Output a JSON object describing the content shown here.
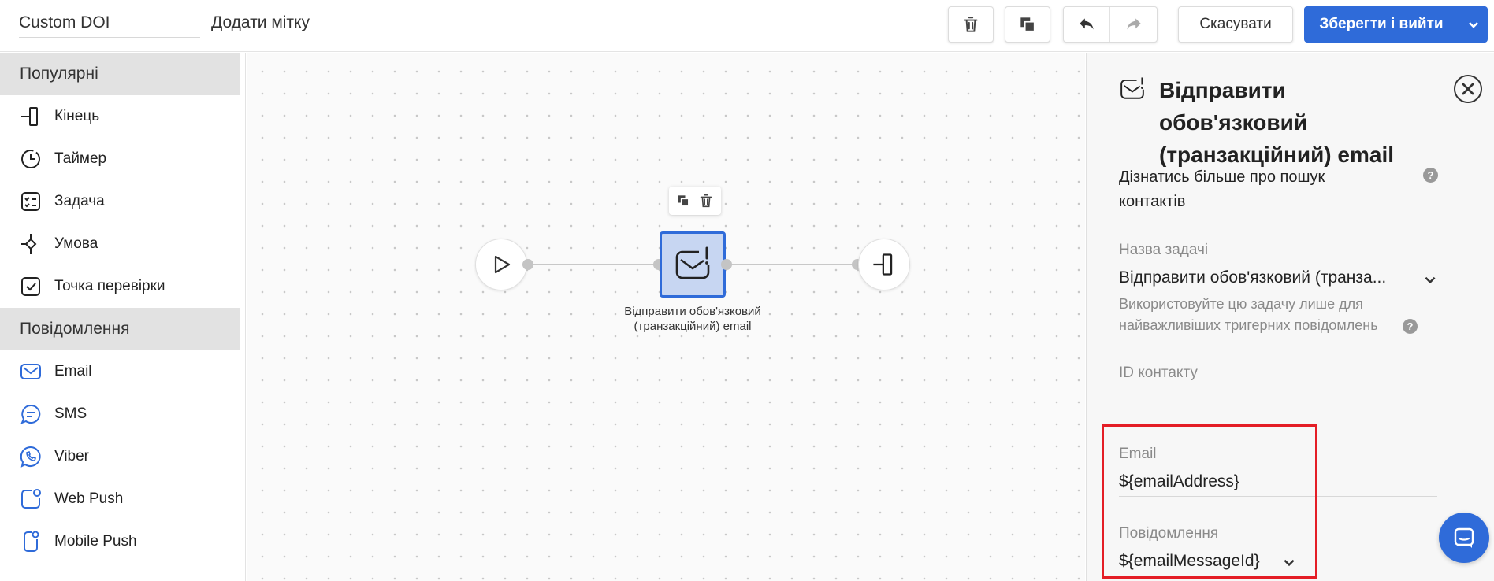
{
  "header": {
    "scenario_name": "Custom DOI",
    "add_tag_label": "Додати мітку",
    "cancel_label": "Скасувати",
    "save_label": "Зберегти і вийти"
  },
  "sidebar": {
    "sections": [
      {
        "title": "Популярні",
        "items": [
          {
            "label": "Кінець",
            "icon": "end-icon"
          },
          {
            "label": "Таймер",
            "icon": "timer-icon"
          },
          {
            "label": "Задача",
            "icon": "task-icon"
          },
          {
            "label": "Умова",
            "icon": "condition-icon"
          },
          {
            "label": "Точка перевірки",
            "icon": "checkpoint-icon"
          }
        ]
      },
      {
        "title": "Повідомлення",
        "items": [
          {
            "label": "Email",
            "icon": "email-icon"
          },
          {
            "label": "SMS",
            "icon": "sms-icon"
          },
          {
            "label": "Viber",
            "icon": "viber-icon"
          },
          {
            "label": "Web Push",
            "icon": "web-push-icon"
          },
          {
            "label": "Mobile Push",
            "icon": "mobile-push-icon"
          }
        ]
      }
    ]
  },
  "canvas": {
    "node_label": "Відправити обов'язковий (транзакційний) email"
  },
  "panel": {
    "title": "Відправити обов'язковий (транзакційний) email",
    "learn_more": "Дізнатись більше про пошук контактів",
    "task_name_label": "Назва задачі",
    "task_name_value": "Відправити обов'язковий (транза...",
    "task_hint": "Використовуйте цю задачу лише для найважливіших тригерних повідомлень",
    "contact_id_label": "ID контакту",
    "contact_id_value": "",
    "email_label": "Email",
    "email_value": "${emailAddress}",
    "message_label": "Повідомлення",
    "message_value": "${emailMessageId}"
  },
  "colors": {
    "accent": "#2f6bd9",
    "node_fill": "#c7d6f2",
    "highlight": "#e41e26"
  }
}
